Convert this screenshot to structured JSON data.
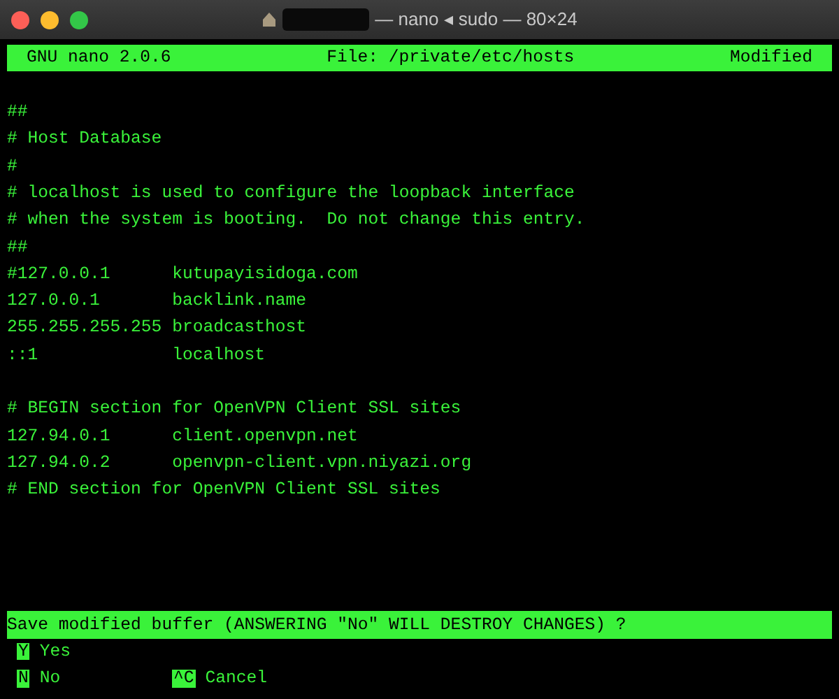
{
  "window": {
    "title": "— nano ◂ sudo — 80×24"
  },
  "header": {
    "version": "GNU nano 2.0.6",
    "file": "File: /private/etc/hosts",
    "state": "Modified"
  },
  "paragraphs": [
    [
      "##",
      "# Host Database",
      "#",
      "# localhost is used to configure the loopback interface",
      "# when the system is booting.  Do not change this entry.",
      "##",
      "#127.0.0.1      kutupayisidoga.com",
      "127.0.0.1       backlink.name",
      "255.255.255.255 broadcasthost",
      "::1             localhost"
    ],
    [
      "# BEGIN section for OpenVPN Client SSL sites",
      "127.94.0.1      client.openvpn.net",
      "127.94.0.2      openvpn-client.vpn.niyazi.org",
      "# END section for OpenVPN Client SSL sites"
    ]
  ],
  "prompt": "Save modified buffer (ANSWERING \"No\" WILL DESTROY CHANGES) ?",
  "shortcut_rows": [
    [
      {
        "key": "Y",
        "label": "Yes"
      }
    ],
    [
      {
        "key": "N",
        "label": "No"
      },
      {
        "key": "^C",
        "label": "Cancel"
      }
    ]
  ]
}
